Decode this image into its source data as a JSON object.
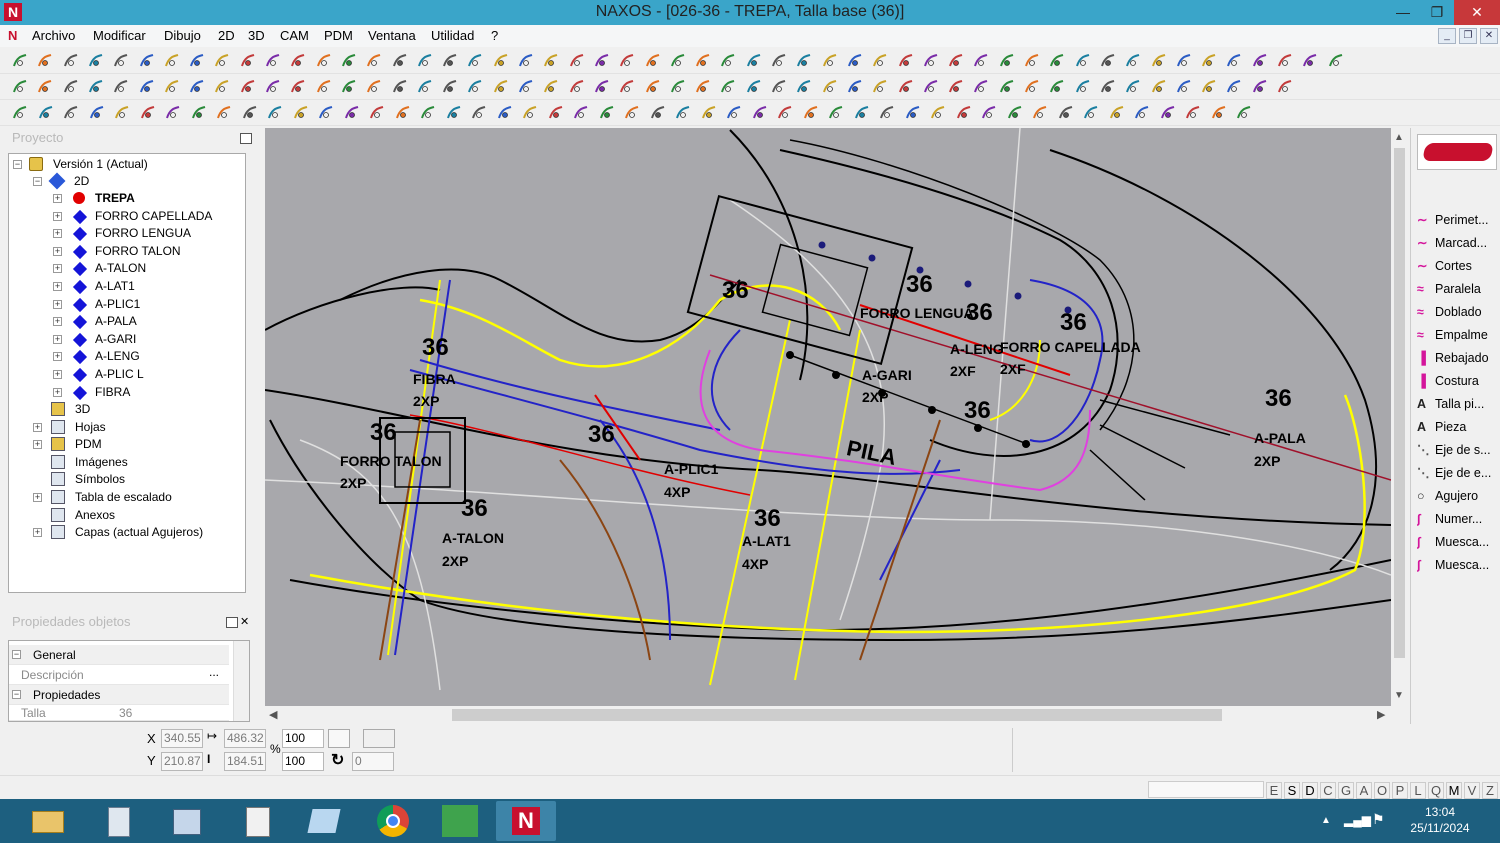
{
  "window": {
    "title": "NAXOS - [026-36 - TREPA, Talla base (36)]"
  },
  "menu": [
    "Archivo",
    "Modificar",
    "Dibujo",
    "2D",
    "3D",
    "CAM",
    "PDM",
    "Ventana",
    "Utilidad",
    "?"
  ],
  "project_panel": {
    "title": "Proyecto",
    "root": "Versión 1 (Actual)",
    "node_2d": "2D",
    "pieces": [
      {
        "label": "TREPA",
        "active": true
      },
      {
        "label": "FORRO CAPELLADA"
      },
      {
        "label": "FORRO LENGUA"
      },
      {
        "label": "FORRO TALON"
      },
      {
        "label": "A-TALON"
      },
      {
        "label": "A-LAT1"
      },
      {
        "label": "A-PLIC1"
      },
      {
        "label": "A-PALA"
      },
      {
        "label": "A-GARI"
      },
      {
        "label": "A-LENG"
      },
      {
        "label": "A-PLIC L"
      },
      {
        "label": "FIBRA"
      }
    ],
    "other_nodes": [
      "3D",
      "Hojas",
      "PDM",
      "Imágenes",
      "Símbolos",
      "Tabla de escalado",
      "Anexos",
      "Capas (actual Agujeros)"
    ]
  },
  "props_panel": {
    "title": "Propiedades objetos",
    "general": "General",
    "descripcion_label": "Descripción",
    "propiedades": "Propiedades",
    "talla_label": "Talla",
    "talla_value": "36"
  },
  "right_panel": {
    "items": [
      "Perimet...",
      "Marcad...",
      "Cortes",
      "Paralela",
      "Doblado",
      "Empalme",
      "Rebajado",
      "Costura",
      "Talla pi...",
      "Pieza",
      "Eje de s...",
      "Eje de e...",
      "Agujero",
      "Numer...",
      "Muesca...",
      "Muesca..."
    ]
  },
  "canvas_labels": {
    "size36": "36",
    "fibra": "FIBRA",
    "forro_talon": "FORRO TALON",
    "a_talon": "A-TALON",
    "a_plic1": "A-PLIC1",
    "a_lat1": "A-LAT1",
    "a_gari": "A-GARI",
    "a_leng": "A-LENG",
    "forro_lengua": "FORRO LENGUA",
    "forro_capellada": "FORRO CAPELLADA",
    "a_pala": "A-PALA",
    "pila": "PILA",
    "x2": "2XP",
    "x4": "4XP",
    "x2b": "2XF"
  },
  "status": {
    "x_label": "X",
    "y_label": "Y",
    "x_val": "340.55",
    "w_val": "486.32",
    "y_val": "210.87",
    "h_val": "184.51",
    "scale_x": "100",
    "scale_y": "100",
    "pct": "%",
    "rotation": "0"
  },
  "layer_letters": [
    "E",
    "S",
    "D",
    "C",
    "G",
    "A",
    "O",
    "P",
    "L",
    "Q",
    "M",
    "V",
    "Z"
  ],
  "clock": {
    "time": "13:04",
    "date": "25/11/2024"
  },
  "colors": {
    "titlebar": "#3aa5c9",
    "canvas": "#a8a8ac",
    "taskbar": "#1d5f7f",
    "yellow": "#ffff00",
    "blue": "#2323c8",
    "red": "#e10000"
  }
}
